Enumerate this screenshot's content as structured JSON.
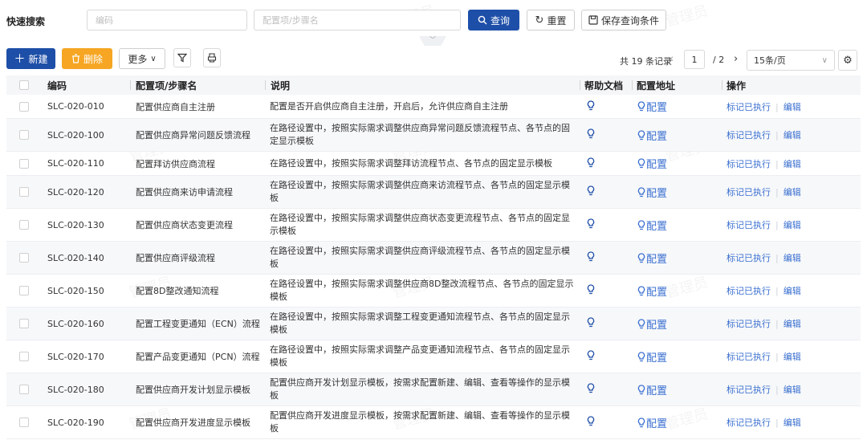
{
  "search": {
    "label": "快速搜索",
    "code_placeholder": "编码",
    "name_placeholder": "配置项/步骤名",
    "query_label": "查询",
    "reset_label": "重置",
    "save_label": "保存查询条件"
  },
  "toolbar": {
    "new_label": "新建",
    "delete_label": "删除",
    "more_label": "更多"
  },
  "pager": {
    "total": "共 19 条记录",
    "current_page": "1",
    "of_pages": "/ 2",
    "page_size": "15条/页"
  },
  "watermark": "管理员",
  "table": {
    "headers": [
      "编码",
      "配置项/步骤名",
      "说明",
      "帮助文档",
      "配置地址",
      "操作"
    ],
    "config_link": "配置",
    "op_mark": "标记已执行",
    "op_edit": "编辑",
    "rows": [
      {
        "code": "SLC-020-010",
        "name": "配置供应商自主注册",
        "desc": "配置是否开启供应商自主注册，开启后，允许供应商自主注册"
      },
      {
        "code": "SLC-020-100",
        "name": "配置供应商异常问题反馈流程",
        "desc": "在路径设置中，按照实际需求调整供应商异常问题反馈流程节点、各节点的固定显示模板"
      },
      {
        "code": "SLC-020-110",
        "name": "配置拜访供应商流程",
        "desc": "在路径设置中，按照实际需求调整拜访流程节点、各节点的固定显示模板"
      },
      {
        "code": "SLC-020-120",
        "name": "配置供应商来访申请流程",
        "desc": "在路径设置中，按照实际需求调整供应商来访流程节点、各节点的固定显示模板"
      },
      {
        "code": "SLC-020-130",
        "name": "配置供应商状态变更流程",
        "desc": "在路径设置中，按照实际需求调整供应商状态变更流程节点、各节点的固定显示模板"
      },
      {
        "code": "SLC-020-140",
        "name": "配置供应商评级流程",
        "desc": "在路径设置中，按照实际需求调整供应商评级流程节点、各节点的固定显示模板"
      },
      {
        "code": "SLC-020-150",
        "name": "配置8D整改通知流程",
        "desc": "在路径设置中，按照实际需求调整供应商8D整改流程节点、各节点的固定显示模板"
      },
      {
        "code": "SLC-020-160",
        "name": "配置工程变更通知（ECN）流程",
        "desc": "在路径设置中，按照实际需求调整工程变更通知流程节点、各节点的固定显示模板"
      },
      {
        "code": "SLC-020-170",
        "name": "配置产品变更通知（PCN）流程",
        "desc": "在路径设置中，按照实际需求调整产品变更通知流程节点、各节点的固定显示模板"
      },
      {
        "code": "SLC-020-180",
        "name": "配置供应商开发计划显示模板",
        "desc": "配置供应商开发计划显示模板，按需求配置新建、编辑、查看等操作的显示模板"
      },
      {
        "code": "SLC-020-190",
        "name": "配置供应商开发进度显示模板",
        "desc": "配置供应商开发进度显示模板，按需求配置新建、编辑、查看等操作的显示模板"
      }
    ]
  },
  "colors": {
    "primary": "#1e4fa8",
    "danger": "#f6a623",
    "link": "#3a6fd0"
  }
}
